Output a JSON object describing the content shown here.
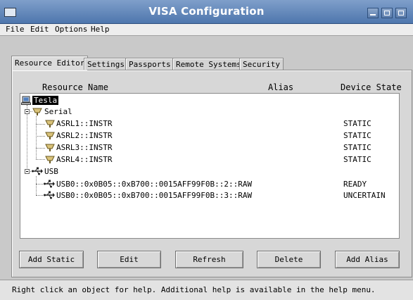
{
  "window": {
    "title": "VISA Configuration"
  },
  "menu": [
    "File",
    "Edit",
    "Options",
    "Help"
  ],
  "tabs": [
    "Resource Editor",
    "Settings",
    "Passports",
    "Remote Systems",
    "Security"
  ],
  "active_tab": "Resource Editor",
  "columns": {
    "name": "Resource Name",
    "alias": "Alias",
    "state": "Device State"
  },
  "tree": {
    "root": "Tesla",
    "serial": {
      "label": "Serial",
      "items": [
        {
          "name": "ASRL1::INSTR",
          "state": "STATIC"
        },
        {
          "name": "ASRL2::INSTR",
          "state": "STATIC"
        },
        {
          "name": "ASRL3::INSTR",
          "state": "STATIC"
        },
        {
          "name": "ASRL4::INSTR",
          "state": "STATIC"
        }
      ]
    },
    "usb": {
      "label": "USB",
      "items": [
        {
          "name": "USB0::0x0B05::0xB700::0015AFF99F0B::2::RAW",
          "state": "READY"
        },
        {
          "name": "USB0::0x0B05::0xB700::0015AFF99F0B::3::RAW",
          "state": "UNCERTAIN"
        }
      ]
    }
  },
  "buttons": {
    "add_static": "Add Static",
    "edit": "Edit",
    "refresh": "Refresh",
    "delete": "Delete",
    "add_alias": "Add Alias"
  },
  "status": "Right click an object for help.  Additional help is available in the help menu."
}
